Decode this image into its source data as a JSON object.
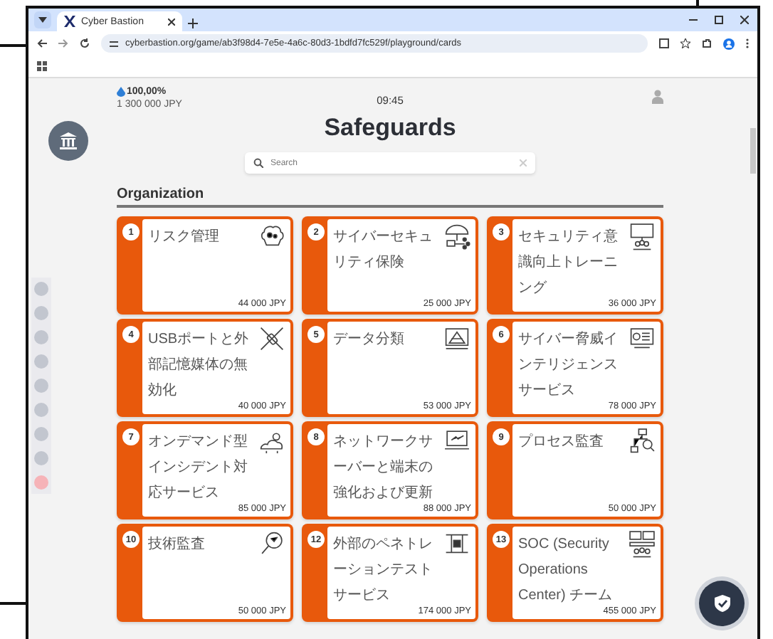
{
  "browser": {
    "tab_title": "Cyber Bastion",
    "url": "cyberbastion.org/game/ab3f98d4-7e5e-4a6c-80d3-1bdfd7fc529f/playground/cards"
  },
  "header": {
    "score": "100,00%",
    "budget": "1 300 000 JPY",
    "time": "09:45"
  },
  "title": "Safeguards",
  "search": {
    "placeholder": "Search"
  },
  "steps": [
    {
      "selected": false
    },
    {
      "selected": false
    },
    {
      "selected": false
    },
    {
      "selected": false
    },
    {
      "selected": false
    },
    {
      "selected": false
    },
    {
      "selected": false
    },
    {
      "selected": false
    },
    {
      "selected": true
    }
  ],
  "section": {
    "title": "Organization",
    "cards": [
      {
        "number": "1",
        "name": "リスク管理",
        "price": "44 000 JPY"
      },
      {
        "number": "2",
        "name": "サイバーセキュリティ保険",
        "price": "25 000 JPY"
      },
      {
        "number": "3",
        "name": "セキュリティ意識向上トレーニング",
        "price": "36 000 JPY"
      },
      {
        "number": "4",
        "name": "USBポートと外部記憶媒体の無効化",
        "price": "40 000 JPY"
      },
      {
        "number": "5",
        "name": "データ分類",
        "price": "53 000 JPY"
      },
      {
        "number": "6",
        "name": "サイバー脅威インテリジェンスサービス",
        "price": "78 000 JPY"
      },
      {
        "number": "7",
        "name": "オンデマンド型インシデント対応サービス",
        "price": "85 000 JPY"
      },
      {
        "number": "8",
        "name": "ネットワークサーバーと端末の強化および更新",
        "price": "88 000 JPY"
      },
      {
        "number": "9",
        "name": "プロセス監査",
        "price": "50 000 JPY"
      },
      {
        "number": "10",
        "name": "技術監査",
        "price": "50 000 JPY"
      },
      {
        "number": "12",
        "name": "外部のペネトレーションテストサービス",
        "price": "174 000 JPY"
      },
      {
        "number": "13",
        "name": "SOC (Security Operations Center) チーム",
        "price": "455 000 JPY"
      }
    ]
  }
}
